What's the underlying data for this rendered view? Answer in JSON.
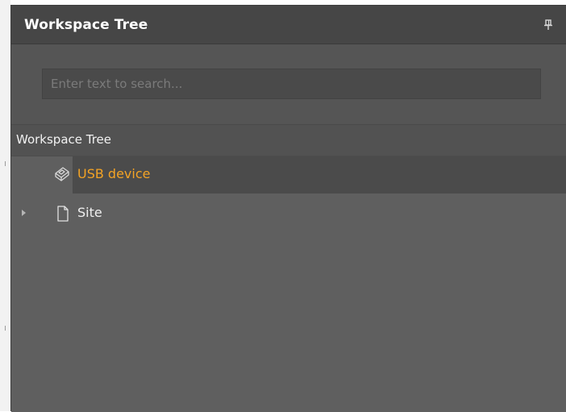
{
  "panel": {
    "title": "Workspace Tree",
    "pin_icon": "pin-icon"
  },
  "search": {
    "placeholder": "Enter text to search...",
    "value": ""
  },
  "tree": {
    "header_label": "Workspace Tree",
    "items": [
      {
        "label": "USB device",
        "icon": "usb-device-icon",
        "selected": true,
        "color": "#f3a325"
      },
      {
        "label": "Site",
        "icon": "document-icon",
        "expandable": true,
        "color": "#f0f0f0"
      }
    ]
  },
  "colors": {
    "panel_bg": "#5f5f5f",
    "header_bg": "#464646",
    "accent": "#f3a325",
    "selection_bg": "#4b4b4b"
  }
}
